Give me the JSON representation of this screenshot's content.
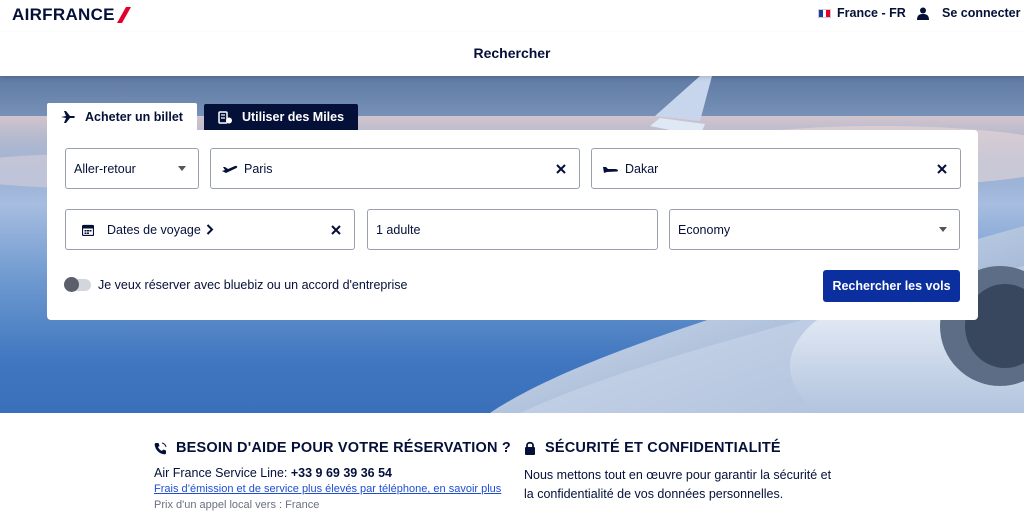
{
  "header": {
    "logo_text": "AIRFRANCE",
    "locale_label": "France - FR",
    "signin_label": "Se connecter"
  },
  "search_bar": {
    "title": "Rechercher"
  },
  "tabs": [
    {
      "label": "Acheter un billet",
      "active": true
    },
    {
      "label": "Utiliser des Miles",
      "active": false
    }
  ],
  "form": {
    "trip_type": "Aller-retour",
    "origin": "Paris",
    "destination": "Dakar",
    "dates_label": "Dates de voyage",
    "passengers": "1 adulte",
    "cabin": "Economy",
    "business_toggle_label": "Je veux réserver avec bluebiz ou un accord d'entreprise",
    "business_toggle_on": false,
    "search_button": "Rechercher les vols"
  },
  "help": {
    "title": "BESOIN D'AIDE POUR VOTRE RÉSERVATION ?",
    "service_label": "Air France Service Line:",
    "phone": "+33 9 69 39 36 54",
    "fees_link": "Frais d’émission et de service plus élevés par téléphone, en savoir plus",
    "local_call": "Prix d'un appel local vers : France"
  },
  "security": {
    "title": "SÉCURITÉ ET CONFIDENTIALITÉ",
    "text": "Nous mettons tout en œuvre pour garantir la sécurité et la confidentialité de vos données personnelles."
  },
  "colors": {
    "navy": "#051039",
    "primary_button": "#0b2f9e",
    "brand_red": "#e4002b",
    "link": "#1f4fd1"
  }
}
